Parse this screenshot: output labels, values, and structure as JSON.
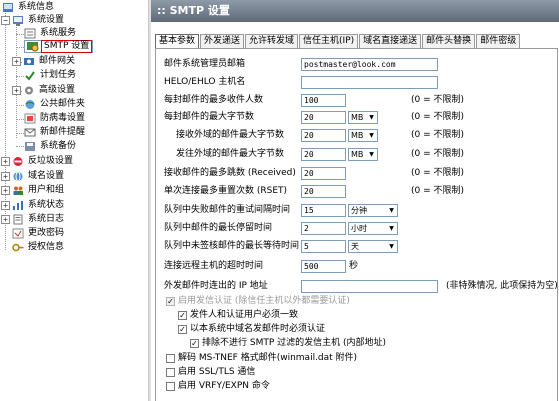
{
  "tree": {
    "root": "系统信息",
    "items": [
      {
        "label": "系统设置",
        "icon": "system-settings-icon"
      },
      {
        "label": "系统服务",
        "icon": "service-icon"
      },
      {
        "label": "SMTP 设置",
        "icon": "smtp-icon"
      },
      {
        "label": "邮件网关",
        "icon": "gateway-icon"
      },
      {
        "label": "计划任务",
        "icon": "task-icon"
      },
      {
        "label": "高级设置",
        "icon": "advanced-icon"
      },
      {
        "label": "公共邮件夹",
        "icon": "public-folder-icon"
      },
      {
        "label": "防病毒设置",
        "icon": "antivirus-icon"
      },
      {
        "label": "新邮件提醒",
        "icon": "notify-icon"
      },
      {
        "label": "系统备份",
        "icon": "backup-icon"
      },
      {
        "label": "反垃圾设置",
        "icon": "antispam-icon"
      },
      {
        "label": "域名设置",
        "icon": "domain-icon"
      },
      {
        "label": "用户和组",
        "icon": "users-icon"
      },
      {
        "label": "系统状态",
        "icon": "status-icon"
      },
      {
        "label": "系统日志",
        "icon": "log-icon"
      },
      {
        "label": "更改密码",
        "icon": "password-icon"
      },
      {
        "label": "授权信息",
        "icon": "license-icon"
      }
    ]
  },
  "panel": {
    "title": ":: SMTP 设置",
    "tabs": [
      "基本参数",
      "外发递送",
      "允许转发域",
      "信任主机(IP)",
      "域名直接递送",
      "邮件头替换",
      "邮件密级"
    ]
  },
  "form": {
    "admin_mail_label": "邮件系统管理员邮箱",
    "admin_mail_value": "postmaster@look.com",
    "helo_label": "HELO/EHLO 主机名",
    "helo_value": "",
    "max_rcpt_label": "每封邮件的最多收件人数",
    "max_rcpt_value": "100",
    "max_rcpt_hint": "(0 = 不限制)",
    "max_size_label": "每封邮件的最大字节数",
    "max_size_value": "20",
    "max_size_unit": "MB",
    "max_size_hint": "(0 = 不限制)",
    "recv_ext_label": "接收外域的邮件最大字节数",
    "recv_ext_value": "20",
    "recv_ext_unit": "MB",
    "recv_ext_hint": "(0 = 不限制)",
    "send_ext_label": "发往外域的邮件最大字节数",
    "send_ext_value": "20",
    "send_ext_unit": "MB",
    "send_ext_hint": "(0 = 不限制)",
    "hops_label": "接收邮件的最多跳数 (Received)",
    "hops_value": "20",
    "hops_hint": "(0 = 不限制)",
    "retry_label": "单次连接最多重置次数 (RSET)",
    "retry_value": "20",
    "retry_hint": "(0 = 不限制)",
    "retry_interval_label": "队列中失败邮件的重试间隔时间",
    "retry_interval_value": "15",
    "retry_interval_unit": "分钟",
    "queue_max_label": "队列中邮件的最长停留时间",
    "queue_max_value": "2",
    "queue_max_unit": "小时",
    "unsigned_wait_label": "队列中未签核邮件的最长等待时间",
    "unsigned_wait_value": "5",
    "unsigned_wait_unit": "天",
    "timeout_label": "连接远程主机的超时时间",
    "timeout_value": "500",
    "timeout_unit": "秒",
    "outbound_ip_label": "外发邮件时连出的 IP 地址",
    "outbound_ip_value": "",
    "outbound_ip_hint": "(非特殊情况, 此项保持为空)"
  },
  "checks": [
    {
      "label": "启用发信认证 (除信任主机以外都需要认证)",
      "checked": true,
      "disabled": true
    },
    {
      "label": "发件人和认证用户必须一致",
      "checked": true,
      "disabled": false
    },
    {
      "label": "以本系统中域名发邮件时必须认证",
      "checked": true,
      "disabled": false
    },
    {
      "label": "排除不进行 SMTP 过滤的发信主机 (内部地址)",
      "checked": true,
      "disabled": false
    },
    {
      "label": "解码 MS-TNEF 格式邮件(winmail.dat 附件)",
      "checked": false,
      "disabled": false
    },
    {
      "label": "启用 SSL/TLS 通信",
      "checked": false,
      "disabled": false
    },
    {
      "label": "启用 VRFY/EXPN 命令",
      "checked": false,
      "disabled": false
    }
  ],
  "colors": {
    "header_bg": "#6f7b89",
    "selected_border": "#dd0000",
    "input_border": "#7f9db9"
  }
}
